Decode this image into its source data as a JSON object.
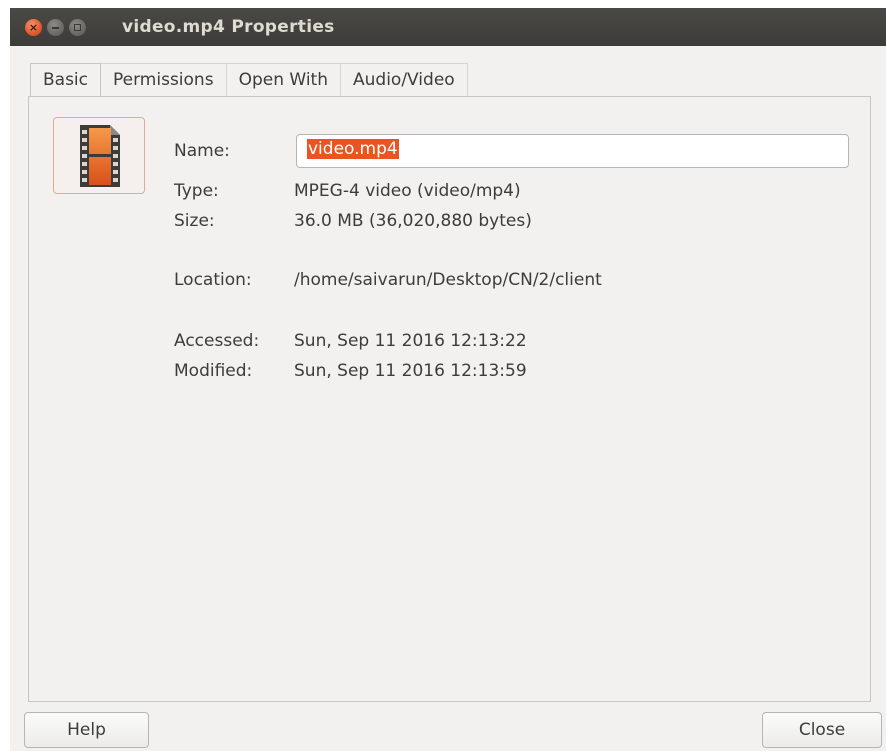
{
  "window": {
    "title": "video.mp4 Properties"
  },
  "tabs": [
    {
      "label": "Basic"
    },
    {
      "label": "Permissions"
    },
    {
      "label": "Open With"
    },
    {
      "label": "Audio/Video"
    }
  ],
  "icon": "video-file-icon",
  "fields": {
    "name_label": "Name:",
    "name_value": "video.mp4",
    "type_label": "Type:",
    "type_value": "MPEG-4 video (video/mp4)",
    "size_label": "Size:",
    "size_value": "36.0 MB (36,020,880 bytes)",
    "location_label": "Location:",
    "location_value": "/home/saivarun/Desktop/CN/2/client",
    "accessed_label": "Accessed:",
    "accessed_value": "Sun, Sep 11 2016 12:13:22",
    "modified_label": "Modified:",
    "modified_value": "Sun, Sep 11 2016 12:13:59"
  },
  "buttons": {
    "help": "Help",
    "close": "Close"
  },
  "colors": {
    "accent": "#e95420",
    "titlebar": "#3c3b37"
  }
}
